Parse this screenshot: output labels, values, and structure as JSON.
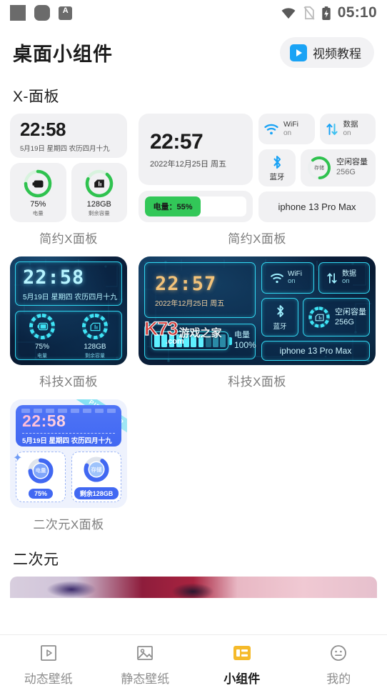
{
  "status_bar": {
    "icons_left": [
      "app-square-icon",
      "app-rounded-square-icon",
      "input-method-icon"
    ],
    "input_method_letter": "A",
    "icons_right": [
      "wifi-icon",
      "no-sim-icon",
      "battery-charging-icon"
    ],
    "time": "05:10"
  },
  "header": {
    "title": "桌面小组件",
    "tutorial_label": "视频教程",
    "tutorial_icon": "play-video-icon"
  },
  "sections": [
    {
      "title": "X-面板"
    },
    {
      "title": "二次元"
    }
  ],
  "widgets": {
    "simple_small": {
      "caption": "简约X面板",
      "clock_time": "22:58",
      "clock_date": "5月19日 星期四 农历四月十九",
      "battery_value": "75%",
      "battery_label": "电量",
      "battery_percent": 75,
      "storage_value": "128GB",
      "storage_label": "剩余容量",
      "storage_percent": 70,
      "battery_icon": "battery-icon",
      "storage_icon": "file-storage-icon",
      "ring_color": "#2fc24f",
      "ring_track": "#d8f3de"
    },
    "simple_large": {
      "caption": "简约X面板",
      "clock_time": "22:57",
      "clock_date": "2022年12月25日 周五",
      "battery_bar_label": "电量：55%",
      "battery_bar_percent": 55,
      "wifi_label": "WiFi",
      "wifi_state": "on",
      "wifi_icon": "wifi-icon",
      "data_label": "数据",
      "data_state": "on",
      "data_icon": "data-transfer-icon",
      "bluetooth_label": "蓝牙",
      "bluetooth_icon": "bluetooth-icon",
      "storage_ring_label": "存储",
      "storage_title": "空闲容量",
      "storage_value": "256G",
      "storage_percent": 60,
      "device_name": "iphone 13 Pro Max",
      "accent": "#1aa3f5",
      "ring_color": "#2fc24f"
    },
    "tech_small": {
      "caption": "科技X面板",
      "clock_time": "22:58",
      "clock_date": "5月19日 星期四 农历四月十九",
      "battery_value": "75%",
      "battery_label": "电量",
      "storage_value": "128GB",
      "storage_label": "剩余容量",
      "battery_icon": "battery-icon",
      "storage_icon": "file-storage-icon",
      "accent": "#3fe3f5"
    },
    "tech_large": {
      "caption": "科技X面板",
      "clock_time": "22:57",
      "clock_date": "2022年12月25日 周五",
      "battery_label": "电量",
      "battery_value": "100%",
      "battery_cells_total": 10,
      "battery_cells_filled": 7,
      "wifi_label": "WiFi",
      "wifi_state": "on",
      "wifi_icon": "wifi-icon",
      "data_label": "数据",
      "data_state": "on",
      "data_icon": "data-transfer-icon",
      "bluetooth_label": "蓝牙",
      "bluetooth_icon": "bluetooth-icon",
      "storage_title": "空闲容量",
      "storage_value": "256G",
      "storage_icon": "file-storage-icon",
      "device_name": "iphone 13 Pro Max",
      "watermark_main": "K73",
      "watermark_sub": ".com",
      "watermark_cn": "游戏之家",
      "accent": "#3fe3f5"
    },
    "anime_small": {
      "caption": "二次元X面板",
      "clock_time": "22:58",
      "clock_date": "5月19日 星期四 农历四月十九",
      "battery_ring_label": "电量",
      "battery_pill": "75%",
      "battery_percent": 75,
      "storage_ring_label": "存储",
      "storage_pill": "剩余128GB",
      "storage_percent": 72,
      "ribbon_text": "PIPI PIPI P",
      "accent": "#4168f2"
    }
  },
  "bottom_nav": {
    "items": [
      {
        "label": "动态壁纸",
        "icon": "live-wallpaper-icon",
        "active": false
      },
      {
        "label": "静态壁纸",
        "icon": "static-wallpaper-icon",
        "active": false
      },
      {
        "label": "小组件",
        "icon": "widget-icon",
        "active": true
      },
      {
        "label": "我的",
        "icon": "profile-icon",
        "active": false
      }
    ],
    "active_color": "#f5ba2a"
  }
}
